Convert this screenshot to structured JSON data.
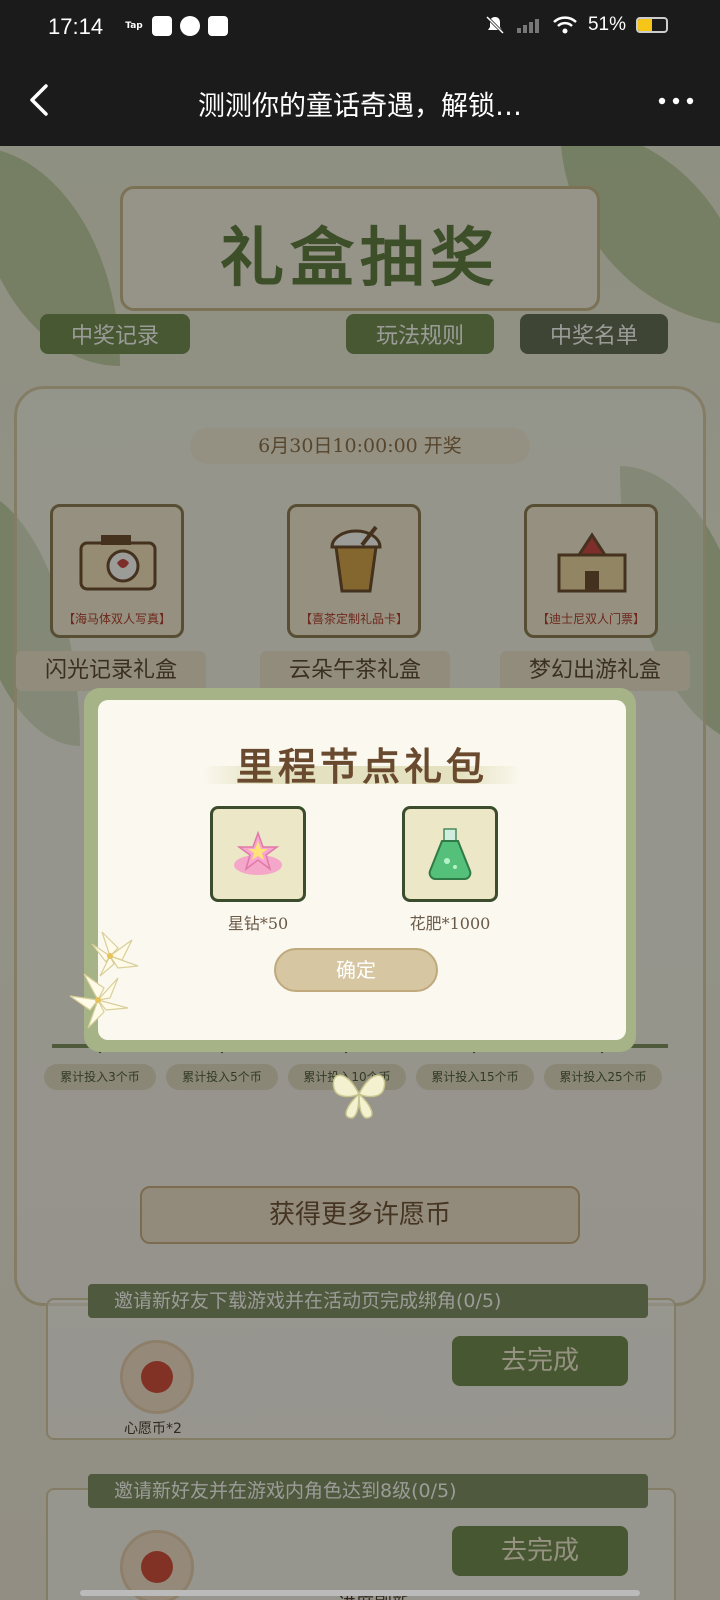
{
  "status_bar": {
    "time": "17:14",
    "app_icons": [
      "Tap",
      "message-icon",
      "leaf-icon",
      "mail-icon"
    ],
    "battery": "51%",
    "battery_level": 0.51
  },
  "nav": {
    "title": "测测你的童话奇遇，解锁…"
  },
  "page": {
    "banner_title": "礼盒抽奖",
    "buttons": [
      "中奖记录",
      "玩法规则",
      "中奖名单"
    ],
    "draw_date": "6月30日10:00:00 开奖",
    "prizes": [
      {
        "caption": "【海马体双人写真】",
        "box_name": "闪光记录礼盒"
      },
      {
        "caption": "【喜茶定制礼品卡】",
        "box_name": "云朵午茶礼盒"
      },
      {
        "caption": "【迪士尼双人门票】",
        "box_name": "梦幻出游礼盒"
      }
    ],
    "milestones": [
      "累计投入3个币",
      "累计投入5个币",
      "累计投入10个币",
      "累计投入15个币",
      "累计投入25个币"
    ],
    "section_title": "获得更多许愿币",
    "tasks": [
      {
        "title": "邀请新好友下载游戏并在活动页完成绑角(0/5)",
        "reward": "心愿币*2",
        "action": "去完成"
      },
      {
        "title": "邀请新好友并在游戏内角色达到8级(0/5)",
        "reward": "进度刷新",
        "action": "去完成"
      }
    ]
  },
  "modal": {
    "title": "里程节点礼包",
    "items": [
      {
        "label": "星钻*50",
        "icon": "star-diamond-icon"
      },
      {
        "label": "花肥*1000",
        "icon": "fertilizer-flask-icon"
      }
    ],
    "confirm_label": "确定"
  },
  "colors": {
    "nav_bg": "#1b1b1b",
    "accent_green": "#6f8a4e",
    "modal_border": "#a5b387"
  }
}
